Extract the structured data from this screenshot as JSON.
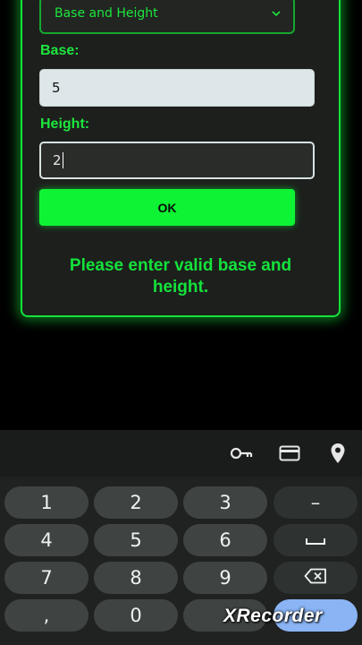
{
  "form": {
    "shape_select": {
      "value": "Base and Height"
    },
    "base": {
      "label": "Base:",
      "value": "5"
    },
    "height": {
      "label": "Height:",
      "value": "2"
    },
    "ok_label": "OK",
    "message_line1": "Please enter valid base and",
    "message_line2": "height."
  },
  "toolbar": {
    "icons": [
      "key-icon",
      "credit-card-icon",
      "location-pin-icon"
    ]
  },
  "keyboard": {
    "rows": [
      [
        "1",
        "2",
        "3",
        "–"
      ],
      [
        "4",
        "5",
        "6",
        "space"
      ],
      [
        "7",
        "8",
        "9",
        "backspace"
      ],
      [
        ",",
        "0",
        ".",
        "action"
      ]
    ],
    "k1": "1",
    "k2": "2",
    "k3": "3",
    "kminus": "–",
    "k4": "4",
    "k5": "5",
    "k6": "6",
    "k7": "7",
    "k8": "8",
    "k9": "9",
    "kcomma": ",",
    "k0": "0",
    "kdot": "."
  },
  "watermark": "XRecorder",
  "colors": {
    "accent_green": "#14e23a",
    "ok_green": "#0ef434",
    "card_bg": "#1d1f1d",
    "keyboard_bg": "#1f2221",
    "key_bg": "#3f4442",
    "action_key": "#8ab4f4"
  }
}
